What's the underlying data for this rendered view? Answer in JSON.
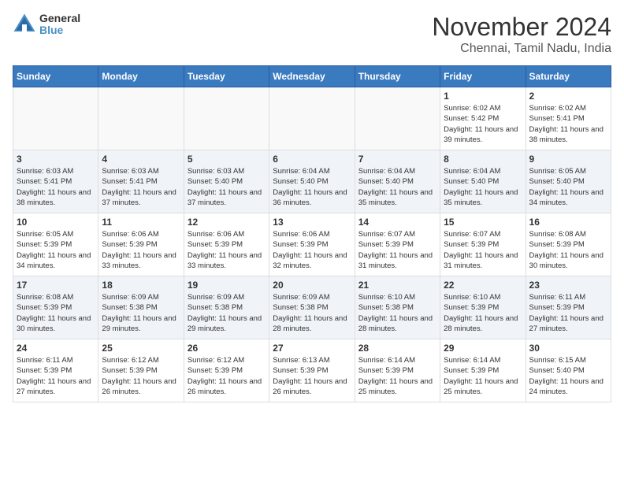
{
  "logo": {
    "text1": "General",
    "text2": "Blue"
  },
  "title": "November 2024",
  "subtitle": "Chennai, Tamil Nadu, India",
  "weekdays": [
    "Sunday",
    "Monday",
    "Tuesday",
    "Wednesday",
    "Thursday",
    "Friday",
    "Saturday"
  ],
  "rows": [
    [
      {
        "day": "",
        "info": ""
      },
      {
        "day": "",
        "info": ""
      },
      {
        "day": "",
        "info": ""
      },
      {
        "day": "",
        "info": ""
      },
      {
        "day": "",
        "info": ""
      },
      {
        "day": "1",
        "info": "Sunrise: 6:02 AM\nSunset: 5:42 PM\nDaylight: 11 hours and 39 minutes."
      },
      {
        "day": "2",
        "info": "Sunrise: 6:02 AM\nSunset: 5:41 PM\nDaylight: 11 hours and 38 minutes."
      }
    ],
    [
      {
        "day": "3",
        "info": "Sunrise: 6:03 AM\nSunset: 5:41 PM\nDaylight: 11 hours and 38 minutes."
      },
      {
        "day": "4",
        "info": "Sunrise: 6:03 AM\nSunset: 5:41 PM\nDaylight: 11 hours and 37 minutes."
      },
      {
        "day": "5",
        "info": "Sunrise: 6:03 AM\nSunset: 5:40 PM\nDaylight: 11 hours and 37 minutes."
      },
      {
        "day": "6",
        "info": "Sunrise: 6:04 AM\nSunset: 5:40 PM\nDaylight: 11 hours and 36 minutes."
      },
      {
        "day": "7",
        "info": "Sunrise: 6:04 AM\nSunset: 5:40 PM\nDaylight: 11 hours and 35 minutes."
      },
      {
        "day": "8",
        "info": "Sunrise: 6:04 AM\nSunset: 5:40 PM\nDaylight: 11 hours and 35 minutes."
      },
      {
        "day": "9",
        "info": "Sunrise: 6:05 AM\nSunset: 5:40 PM\nDaylight: 11 hours and 34 minutes."
      }
    ],
    [
      {
        "day": "10",
        "info": "Sunrise: 6:05 AM\nSunset: 5:39 PM\nDaylight: 11 hours and 34 minutes."
      },
      {
        "day": "11",
        "info": "Sunrise: 6:06 AM\nSunset: 5:39 PM\nDaylight: 11 hours and 33 minutes."
      },
      {
        "day": "12",
        "info": "Sunrise: 6:06 AM\nSunset: 5:39 PM\nDaylight: 11 hours and 33 minutes."
      },
      {
        "day": "13",
        "info": "Sunrise: 6:06 AM\nSunset: 5:39 PM\nDaylight: 11 hours and 32 minutes."
      },
      {
        "day": "14",
        "info": "Sunrise: 6:07 AM\nSunset: 5:39 PM\nDaylight: 11 hours and 31 minutes."
      },
      {
        "day": "15",
        "info": "Sunrise: 6:07 AM\nSunset: 5:39 PM\nDaylight: 11 hours and 31 minutes."
      },
      {
        "day": "16",
        "info": "Sunrise: 6:08 AM\nSunset: 5:39 PM\nDaylight: 11 hours and 30 minutes."
      }
    ],
    [
      {
        "day": "17",
        "info": "Sunrise: 6:08 AM\nSunset: 5:39 PM\nDaylight: 11 hours and 30 minutes."
      },
      {
        "day": "18",
        "info": "Sunrise: 6:09 AM\nSunset: 5:38 PM\nDaylight: 11 hours and 29 minutes."
      },
      {
        "day": "19",
        "info": "Sunrise: 6:09 AM\nSunset: 5:38 PM\nDaylight: 11 hours and 29 minutes."
      },
      {
        "day": "20",
        "info": "Sunrise: 6:09 AM\nSunset: 5:38 PM\nDaylight: 11 hours and 28 minutes."
      },
      {
        "day": "21",
        "info": "Sunrise: 6:10 AM\nSunset: 5:38 PM\nDaylight: 11 hours and 28 minutes."
      },
      {
        "day": "22",
        "info": "Sunrise: 6:10 AM\nSunset: 5:39 PM\nDaylight: 11 hours and 28 minutes."
      },
      {
        "day": "23",
        "info": "Sunrise: 6:11 AM\nSunset: 5:39 PM\nDaylight: 11 hours and 27 minutes."
      }
    ],
    [
      {
        "day": "24",
        "info": "Sunrise: 6:11 AM\nSunset: 5:39 PM\nDaylight: 11 hours and 27 minutes."
      },
      {
        "day": "25",
        "info": "Sunrise: 6:12 AM\nSunset: 5:39 PM\nDaylight: 11 hours and 26 minutes."
      },
      {
        "day": "26",
        "info": "Sunrise: 6:12 AM\nSunset: 5:39 PM\nDaylight: 11 hours and 26 minutes."
      },
      {
        "day": "27",
        "info": "Sunrise: 6:13 AM\nSunset: 5:39 PM\nDaylight: 11 hours and 26 minutes."
      },
      {
        "day": "28",
        "info": "Sunrise: 6:14 AM\nSunset: 5:39 PM\nDaylight: 11 hours and 25 minutes."
      },
      {
        "day": "29",
        "info": "Sunrise: 6:14 AM\nSunset: 5:39 PM\nDaylight: 11 hours and 25 minutes."
      },
      {
        "day": "30",
        "info": "Sunrise: 6:15 AM\nSunset: 5:40 PM\nDaylight: 11 hours and 24 minutes."
      }
    ]
  ]
}
